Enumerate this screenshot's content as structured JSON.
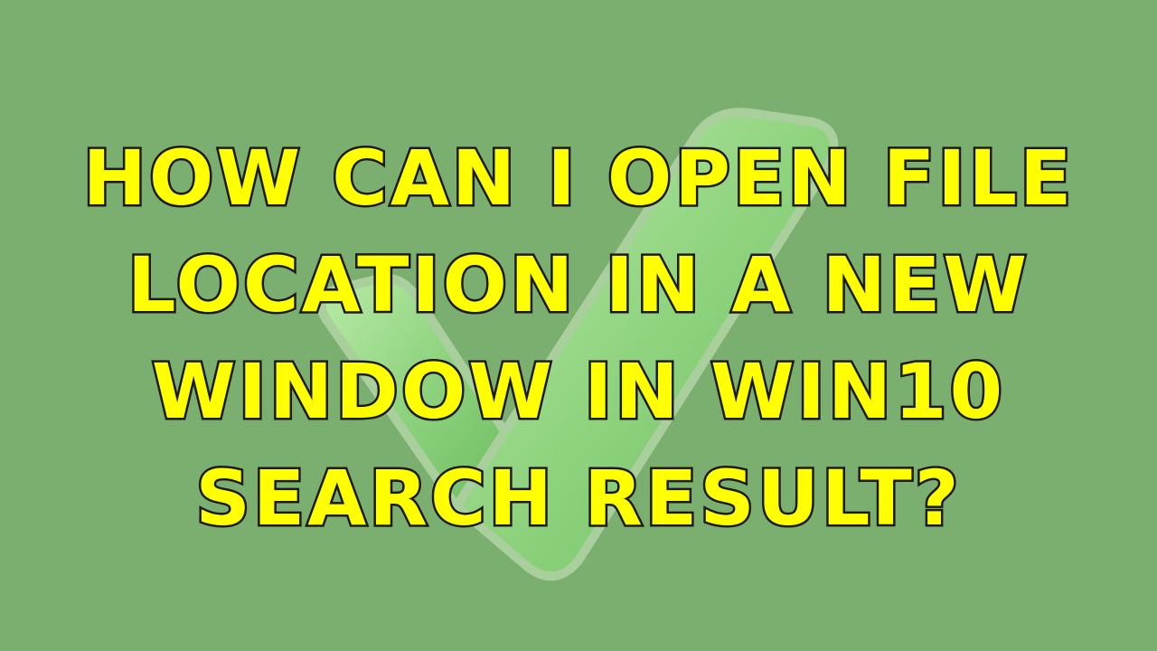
{
  "thumbnail": {
    "background_color": "#7baf6f",
    "text_color": "#ffff00",
    "text_outline_color": "#1a1a1a",
    "background_icon": "checkmark-icon",
    "title_lines": [
      "HOW CAN I OPEN FILE",
      "LOCATION IN A NEW",
      "WINDOW IN WIN10",
      "SEARCH RESULT?"
    ]
  }
}
